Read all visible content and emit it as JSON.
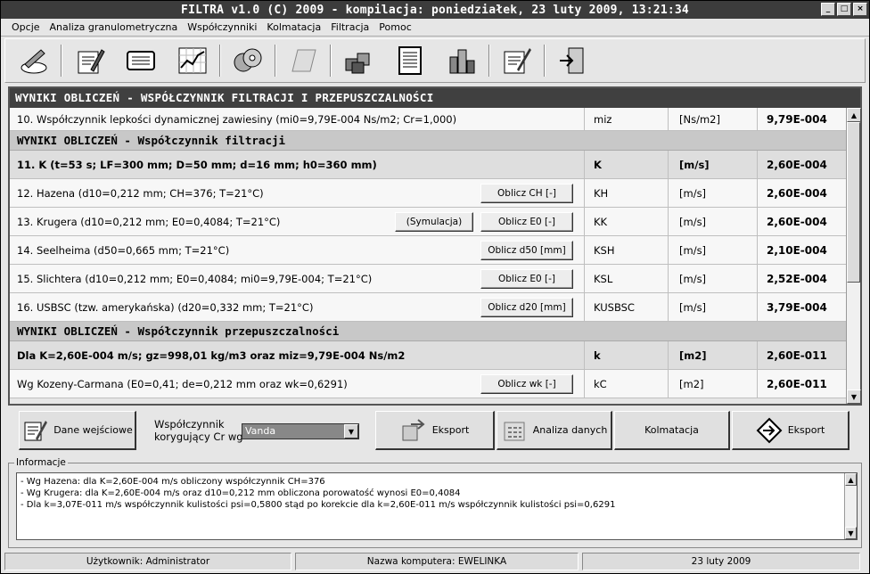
{
  "window": {
    "title": "FILTRA v1.0 (C) 2009 - kompilacja: poniedziałek, 23 luty 2009, 13:21:34"
  },
  "menu": [
    "Opcje",
    "Analiza granulometryczna",
    "Współczynniki",
    "Kolmatacja",
    "Filtracja",
    "Pomoc"
  ],
  "toolbar_icons": [
    "edit-icon",
    "document-edit-icon",
    "list-icon",
    "chart-icon",
    "discs-icon",
    "note-icon",
    "cubes-icon",
    "report-icon",
    "buildings-chart-icon",
    "sign-icon",
    "exit-icon"
  ],
  "panel": {
    "header": "WYNIKI OBLICZEŃ - WSPÓŁCZYNNIK FILTRACJI I PRZEPUSZCZALNOŚCI",
    "rows": [
      {
        "desc": "10. Współczynnik lepkości dynamicznej zawiesiny (mi0=9,79E-004 Ns/m2; Cr=1,000)",
        "sym": "miz",
        "unit": "[Ns/m2]",
        "val": "9,79E-004"
      },
      {
        "section": "WYNIKI OBLICZEŃ - Współczynnik filtracji"
      },
      {
        "desc": "11. K (t=53 s; LF=300 mm; D=50 mm; d=16 mm; h0=360 mm)",
        "sym": "K",
        "unit": "[m/s]",
        "val": "2,60E-004",
        "bold": true
      },
      {
        "desc": "12.  Hazena (d10=0,212 mm; CH=376; T=21°C)",
        "sym": "KH",
        "unit": "[m/s]",
        "val": "2,60E-004",
        "btn": "Oblicz CH [-]"
      },
      {
        "desc": "13. Krugera (d10=0,212 mm; E0=0,4084; T=21°C)",
        "sym": "KK",
        "unit": "[m/s]",
        "val": "2,60E-004",
        "btn": "Oblicz E0 [-]",
        "btn2": "(Symulacja)"
      },
      {
        "desc": "14. Seelheima (d50=0,665 mm; T=21°C)",
        "sym": "KSH",
        "unit": "[m/s]",
        "val": "2,10E-004",
        "btn": "Oblicz d50 [mm]"
      },
      {
        "desc": "15. Slichtera (d10=0,212 mm; E0=0,4084; mi0=9,79E-004; T=21°C)",
        "sym": "KSL",
        "unit": "[m/s]",
        "val": "2,52E-004",
        "btn": "Oblicz E0 [-]"
      },
      {
        "desc": "16. USBSC (tzw. amerykańska) (d20=0,332 mm; T=21°C)",
        "sym": "KUSBSC",
        "unit": "[m/s]",
        "val": "3,79E-004",
        "btn": "Oblicz d20 [mm]"
      },
      {
        "section": "WYNIKI OBLICZEŃ - Współczynnik przepuszczalności"
      },
      {
        "desc": "Dla K=2,60E-004 m/s; gz=998,01 kg/m3 oraz miz=9,79E-004 Ns/m2",
        "sym": "k",
        "unit": "[m2]",
        "val": "2,60E-011",
        "bold": true
      },
      {
        "desc": "Wg Kozeny-Carmana (E0=0,41; de=0,212 mm oraz wk=0,6291)",
        "sym": "kC",
        "unit": "[m2]",
        "val": "2,60E-011",
        "btn": "Oblicz wk [-]"
      }
    ]
  },
  "bottom": {
    "input_data": "Dane wejściowe",
    "corr_label_1": "Współczynnik",
    "corr_label_2": "korygujący Cr wg",
    "corr_value": "Vanda",
    "export1": "Eksport",
    "analysis": "Analiza danych",
    "kolmatacja": "Kolmatacja",
    "export2": "Eksport"
  },
  "info": {
    "legend": "Informacje",
    "lines": [
      "- Wg Hazena: dla K=2,60E-004 m/s obliczony współczynnik CH=376",
      "- Wg Krugera: dla K=2,60E-004 m/s oraz d10=0,212 mm obliczona porowatość wynosi E0=0,4084",
      "- Dla k=3,07E-011 m/s współczynnik kulistości psi=0,5800 stąd po korekcie dla k=2,60E-011 m/s współczynnik kulistości psi=0,6291"
    ]
  },
  "status": {
    "user": "Użytkownik: Administrator",
    "computer": "Nazwa komputera: EWELINKA",
    "date": "23 luty 2009"
  }
}
